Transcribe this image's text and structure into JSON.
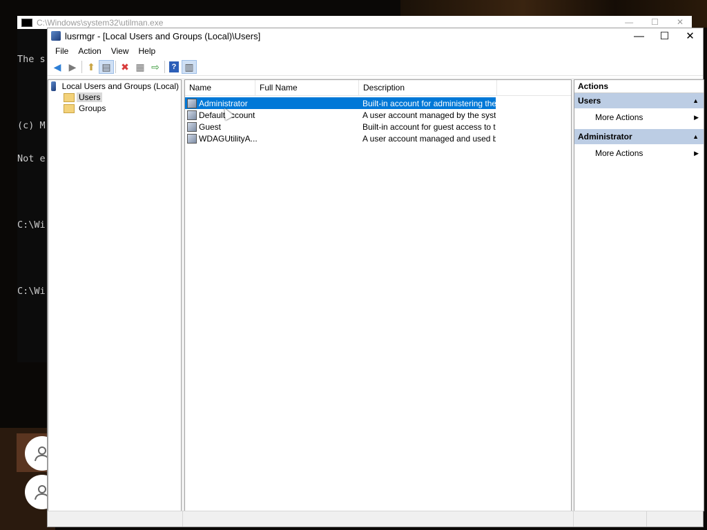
{
  "console": {
    "title": "C:\\Windows\\system32\\utilman.exe",
    "lines": [
      "The s",
      "",
      "(c) M",
      "Not e",
      "",
      "C:\\Wi",
      "",
      "C:\\Wi"
    ]
  },
  "window": {
    "title": "lusrmgr - [Local Users and Groups (Local)\\Users]",
    "controls": {
      "minimize": "—",
      "maximize": "☐",
      "close": "✕"
    }
  },
  "menu": [
    "File",
    "Action",
    "View",
    "Help"
  ],
  "toolbar": {
    "back": "◀",
    "forward": "▶",
    "up": "⬆",
    "show_tree": "▤",
    "delete": "✖",
    "properties": "▦",
    "export": "⇨",
    "help": "?",
    "show_action": "▥"
  },
  "tree": {
    "root": "Local Users and Groups (Local)",
    "children": [
      "Users",
      "Groups"
    ]
  },
  "list": {
    "columns": [
      "Name",
      "Full Name",
      "Description"
    ],
    "rows": [
      {
        "name": "Administrator",
        "full_name": "",
        "description": "Built-in account for administering the c..."
      },
      {
        "name": "DefaultAccount",
        "full_name": "",
        "description": "A user account managed by the syste..."
      },
      {
        "name": "Guest",
        "full_name": "",
        "description": "Built-in account for guest access to th..."
      },
      {
        "name": "WDAGUtilityA...",
        "full_name": "",
        "description": "A user account managed and used b..."
      }
    ]
  },
  "actions": {
    "header": "Actions",
    "sections": [
      {
        "title": "Users",
        "items": [
          "More Actions"
        ]
      },
      {
        "title": "Administrator",
        "items": [
          "More Actions"
        ]
      }
    ],
    "collapse_glyph": "▲",
    "submenu_glyph": "▶"
  },
  "colors": {
    "selection": "#0078d7",
    "section_header": "#bccde4"
  }
}
